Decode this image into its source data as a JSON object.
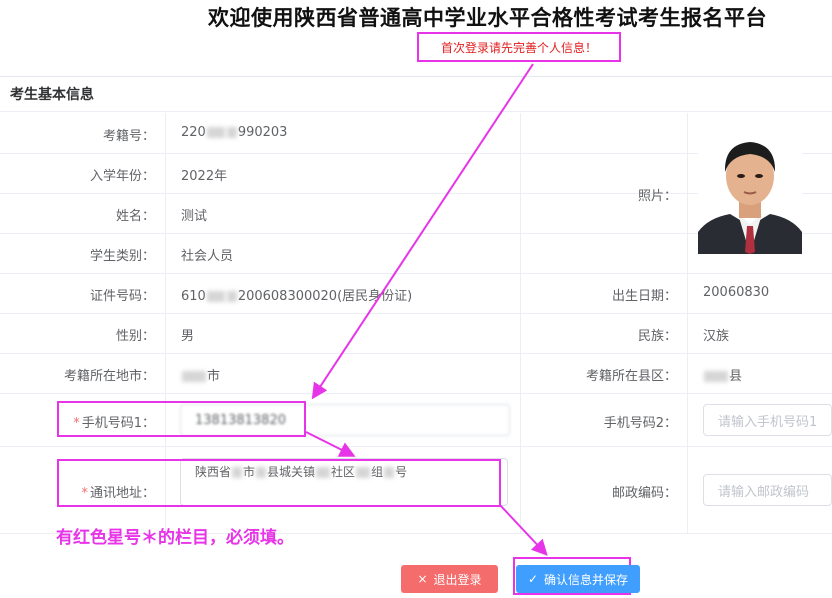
{
  "header": {
    "title": "欢迎使用陕西省普通高中学业水平合格性考试考生报名平台",
    "notice": "首次登录请先完善个人信息！"
  },
  "section": {
    "title": "考生基本信息"
  },
  "fields": {
    "kaoji_label": "考籍号：",
    "kaoji_prefix": "220",
    "kaoji_suffix": "990203",
    "year_label": "入学年份：",
    "year_value": "2022年",
    "name_label": "姓名：",
    "name_value": "测试",
    "type_label": "学生类别：",
    "type_value": "社会人员",
    "photo_label": "照片：",
    "id_label": "证件号码：",
    "id_prefix": "610",
    "id_suffix": "200608300020(居民身份证)",
    "birth_label": "出生日期：",
    "birth_value": "20060830",
    "gender_label": "性别：",
    "gender_value": "男",
    "nation_label": "民族：",
    "nation_value": "汉族",
    "city_label": "考籍所在地市：",
    "city_value": "市",
    "county_label": "考籍所在县区：",
    "county_value": "县",
    "phone1_label": "手机号码1：",
    "phone1_value": "13813813820",
    "phone2_label": "手机号码2：",
    "phone2_placeholder": "请输入手机号码1",
    "address_label": "通讯地址：",
    "address_part1": "陕西省",
    "address_part2": "市",
    "address_part3": "县城关镇",
    "address_part4": "社区",
    "address_part5": "组",
    "address_part6": "号",
    "postal_label": "邮政编码：",
    "postal_placeholder": "请输入邮政编码",
    "required_mark": "*"
  },
  "annotation": {
    "note": "有红色星号＊的栏目，必须填。",
    "color": "#e834e8"
  },
  "buttons": {
    "logout_label": "退出登录",
    "logout_icon": "×",
    "save_label": "确认信息并保存",
    "save_icon": "✓"
  }
}
